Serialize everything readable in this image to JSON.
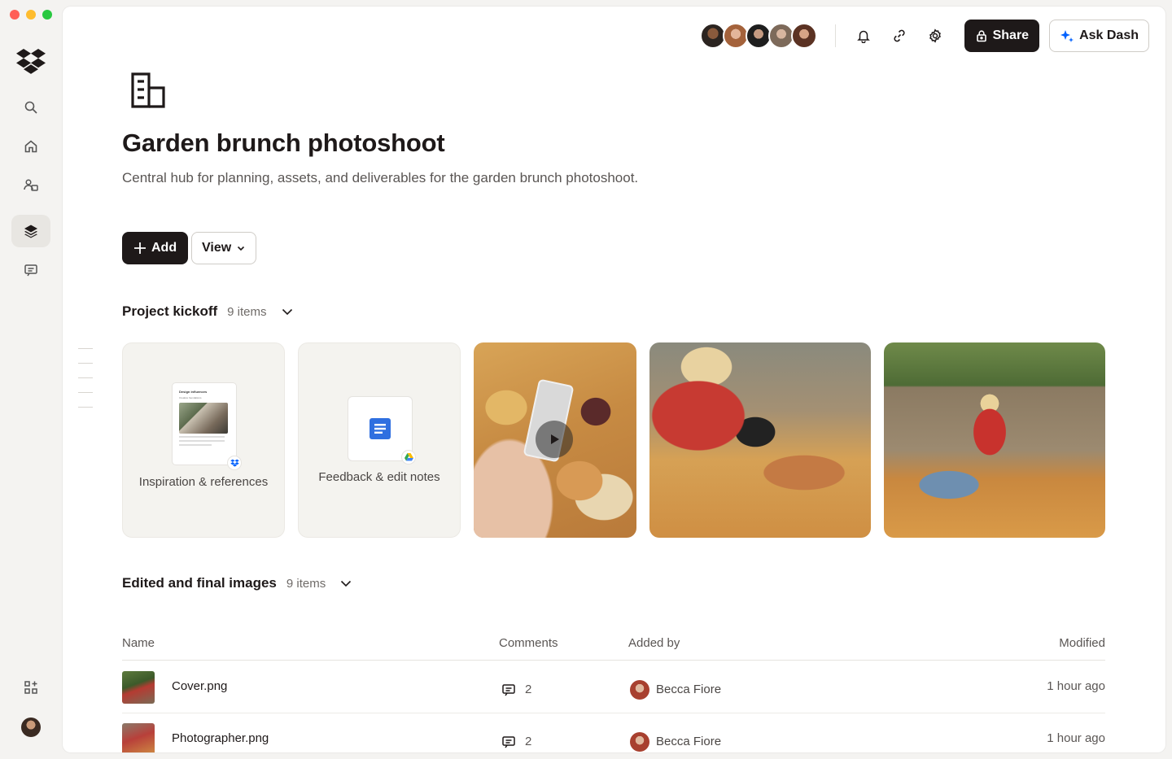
{
  "window": {
    "controls": [
      "close",
      "minimize",
      "zoom"
    ]
  },
  "rail": {
    "logo": "dropbox-logo",
    "items": [
      {
        "icon": "search-icon"
      },
      {
        "icon": "home-icon"
      },
      {
        "icon": "people-icon"
      },
      {
        "icon": "layers-icon",
        "active": true
      },
      {
        "icon": "message-icon"
      }
    ],
    "bottom": [
      {
        "icon": "apps-icon"
      },
      {
        "icon": "profile-avatar"
      }
    ]
  },
  "topbar": {
    "collaborator_count": 5,
    "share_label": "Share",
    "ask_label": "Ask Dash"
  },
  "page": {
    "title": "Garden brunch photoshoot",
    "description": "Central hub for planning, assets, and deliverables for the garden brunch photoshoot.",
    "add_label": "Add",
    "view_label": "View"
  },
  "sections": [
    {
      "title": "Project kickoff",
      "count": "9 items",
      "cards": [
        {
          "type": "doc",
          "label": "Inspiration & references",
          "preview_title": "Design influences",
          "preview_sub": "Creative foundations",
          "source": "dropbox"
        },
        {
          "type": "doc",
          "label": "Feedback & edit notes",
          "source": "google-drive"
        },
        {
          "type": "video"
        },
        {
          "type": "image"
        },
        {
          "type": "image"
        }
      ]
    },
    {
      "title": "Edited and final images",
      "count": "9 items",
      "columns": {
        "name": "Name",
        "comments": "Comments",
        "added_by": "Added by",
        "modified": "Modified"
      },
      "rows": [
        {
          "name": "Cover.png",
          "comments": "2",
          "added_by": "Becca Fiore",
          "modified": "1 hour ago"
        },
        {
          "name": "Photographer.png",
          "comments": "2",
          "added_by": "Becca Fiore",
          "modified": "1 hour ago"
        }
      ]
    }
  ],
  "colors": {
    "primary": "#1e1919",
    "accent": "#0061fe",
    "surface": "#f4f3f1"
  }
}
